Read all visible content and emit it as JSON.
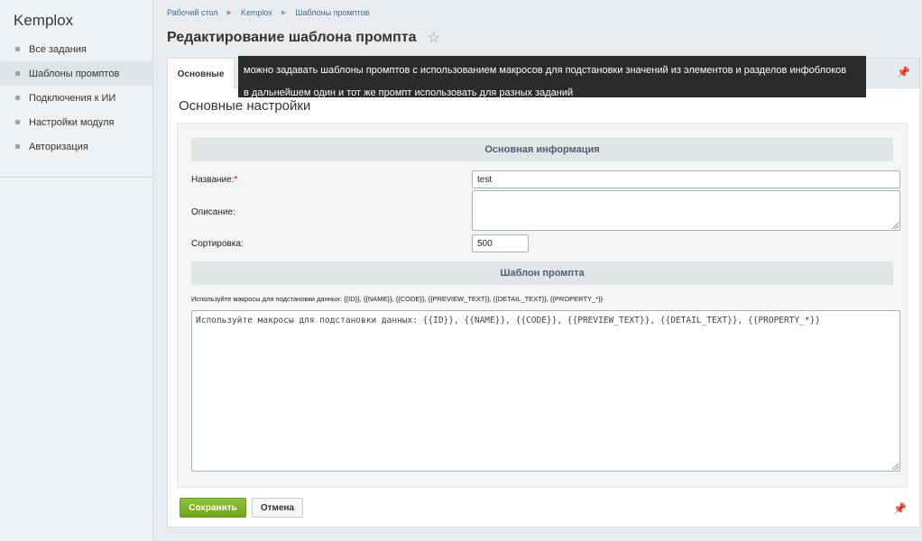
{
  "sidebar": {
    "title": "Kemplox",
    "items": [
      {
        "label": "Все задания"
      },
      {
        "label": "Шаблоны промптов"
      },
      {
        "label": "Подключения к ИИ"
      },
      {
        "label": "Настройки модуля"
      },
      {
        "label": "Авторизация"
      }
    ]
  },
  "breadcrumb": [
    "Рабочий стол",
    "Kemplox",
    "Шаблоны промптов"
  ],
  "page": {
    "title": "Редактирование шаблона промпта",
    "star_icon": "☆",
    "pin_icon": "📌"
  },
  "tabs": [
    {
      "label": "Основные"
    }
  ],
  "tooltip": {
    "line1": "можно задавать шаблоны промптов с использованием макросов для подстановки значений из элементов и разделов инфоблоков",
    "line2": "в дальнейшем один и тот же промпт использовать для разных заданий"
  },
  "section": {
    "title": "Основные настройки"
  },
  "form": {
    "group_main": "Основная информация",
    "name_label": "Название:",
    "required_mark": "*",
    "name_value": "test",
    "description_label": "Описание:",
    "description_value": "",
    "sort_label": "Сортировка:",
    "sort_value": "500",
    "group_template": "Шаблон промпта",
    "hint": "Используйте макросы для подстановки данных: {{ID}}, {{NAME}}, {{CODE}}, {{PREVIEW_TEXT}}, {{DETAIL_TEXT}}, {{PROPERTY_*}}",
    "prompt_value": "Используйте макросы для подстановки данных: {{ID}}, {{NAME}}, {{CODE}}, {{PREVIEW_TEXT}}, {{DETAIL_TEXT}}, {{PROPERTY_*}}"
  },
  "buttons": {
    "save": "Сохранить",
    "cancel": "Отмена"
  }
}
